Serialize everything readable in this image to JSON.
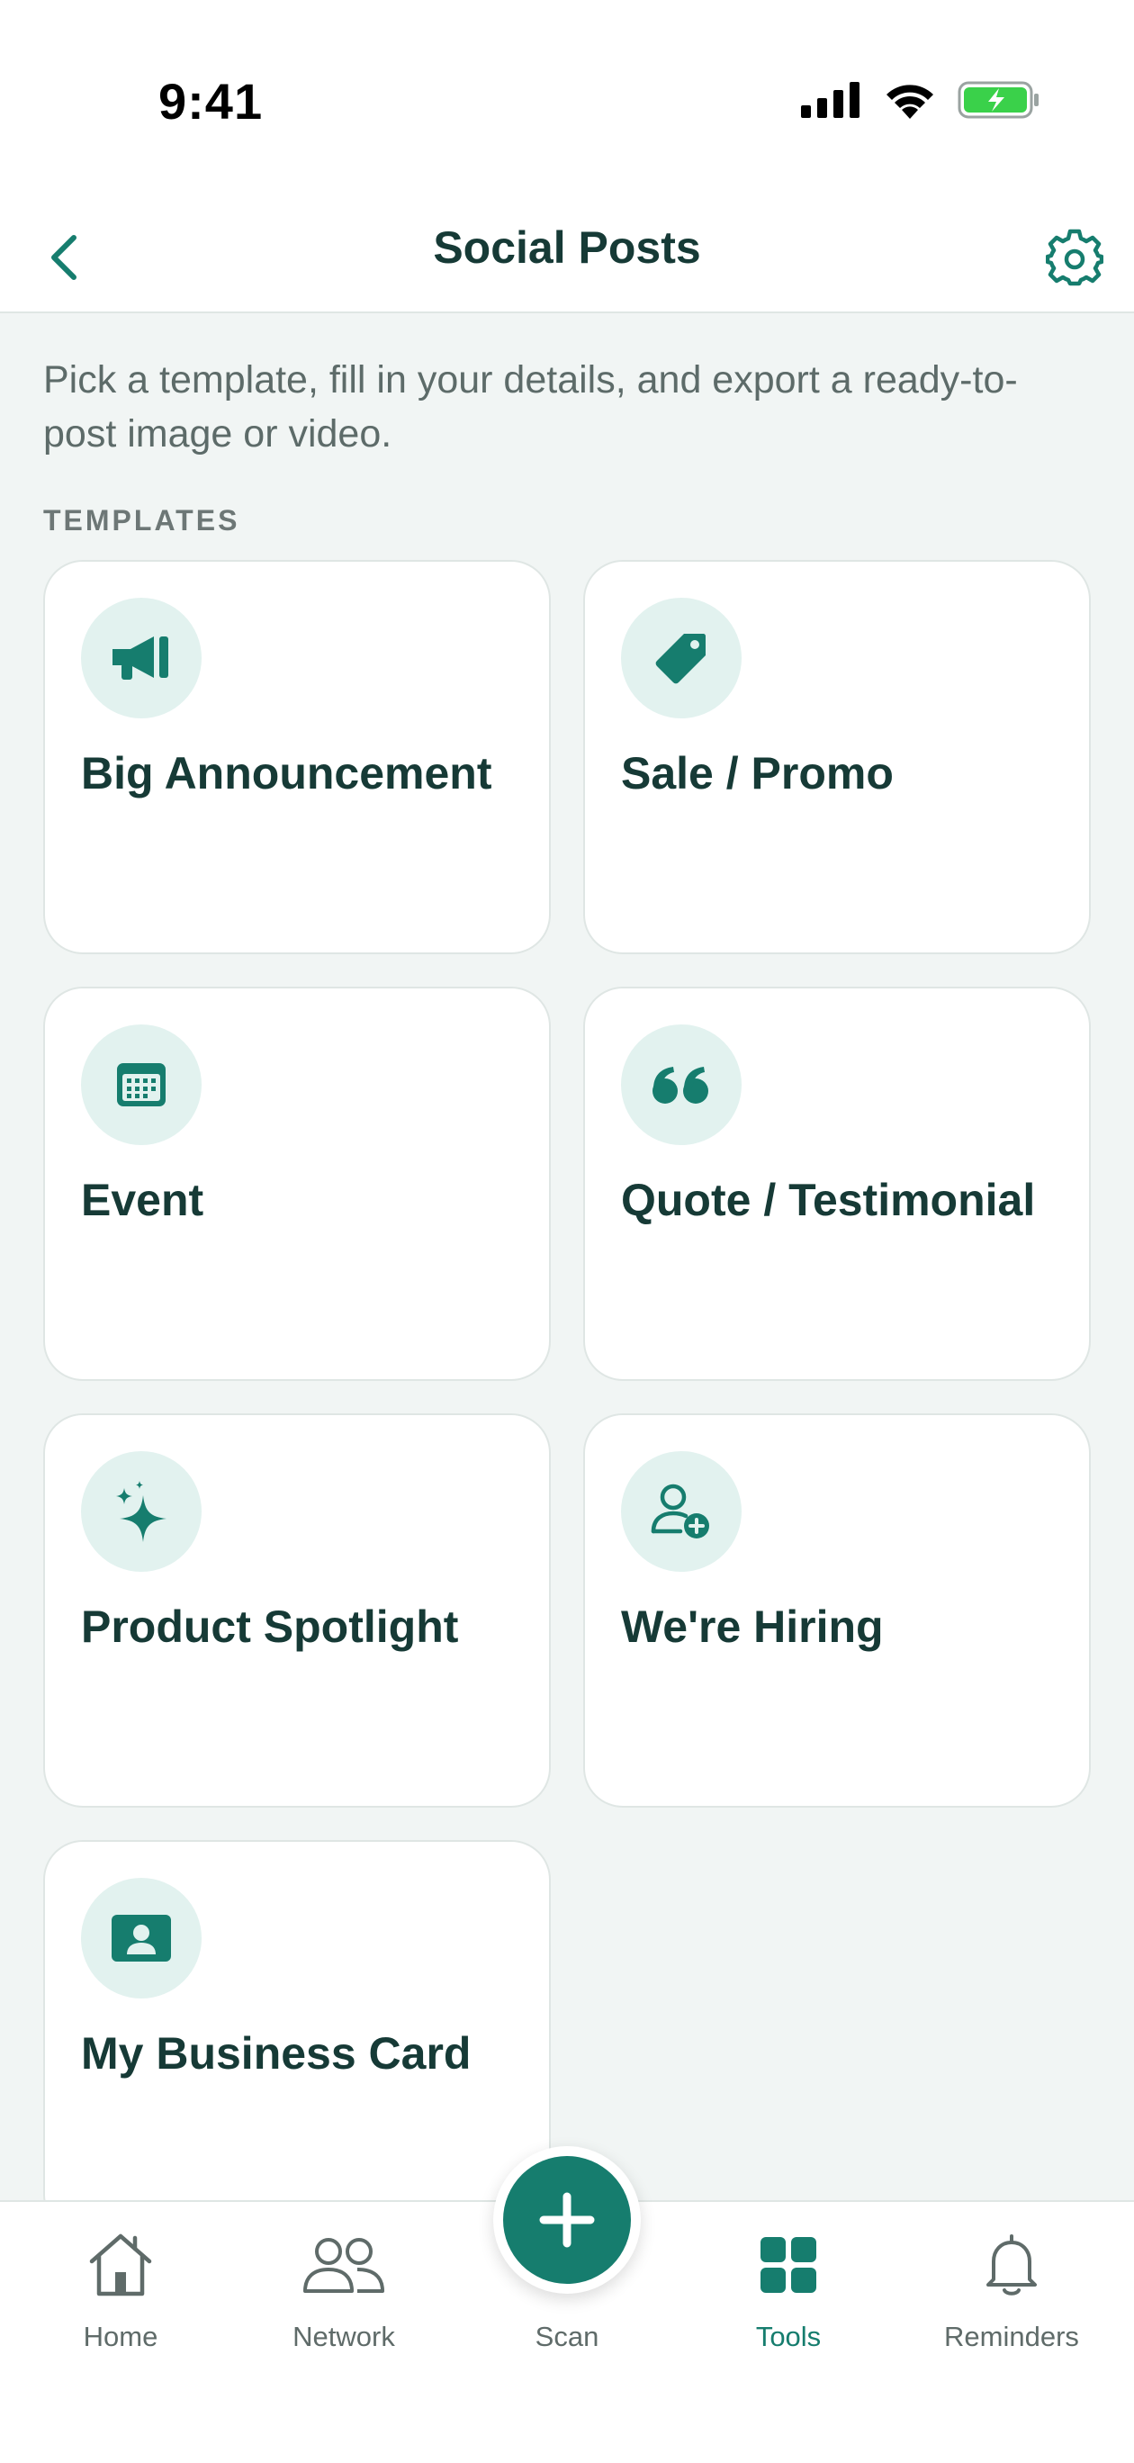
{
  "status_bar": {
    "time": "9:41",
    "icons": [
      "cellular-signal-icon",
      "wifi-icon",
      "battery-charging-icon"
    ]
  },
  "header": {
    "title": "Social Posts",
    "back_icon": "chevron-left-icon",
    "settings_icon": "gear-icon"
  },
  "intro_text": "Pick a template, fill in your details, and export a ready-to-post image or video.",
  "section_label": "TEMPLATES",
  "templates": [
    {
      "title": "Big Announcement",
      "icon": "megaphone-icon"
    },
    {
      "title": "Sale / Promo",
      "icon": "tag-icon"
    },
    {
      "title": "Event",
      "icon": "calendar-icon"
    },
    {
      "title": "Quote / Testimonial",
      "icon": "quote-icon"
    },
    {
      "title": "Product Spotlight",
      "icon": "sparkles-icon"
    },
    {
      "title": "We're Hiring",
      "icon": "user-add-icon"
    },
    {
      "title": "My Business Card",
      "icon": "contact-card-icon"
    }
  ],
  "tabbar": {
    "tabs": [
      {
        "label": "Home",
        "icon": "home-icon",
        "active": false
      },
      {
        "label": "Network",
        "icon": "people-icon",
        "active": false
      },
      {
        "label": "Scan",
        "icon": "plus-icon",
        "active": false
      },
      {
        "label": "Tools",
        "icon": "grid-icon",
        "active": true
      },
      {
        "label": "Reminders",
        "icon": "bell-icon",
        "active": false
      }
    ]
  },
  "colors": {
    "accent": "#167d6e",
    "icon_bg": "#e2f2ef",
    "text_dark": "#163a36",
    "background": "#f1f5f4"
  }
}
